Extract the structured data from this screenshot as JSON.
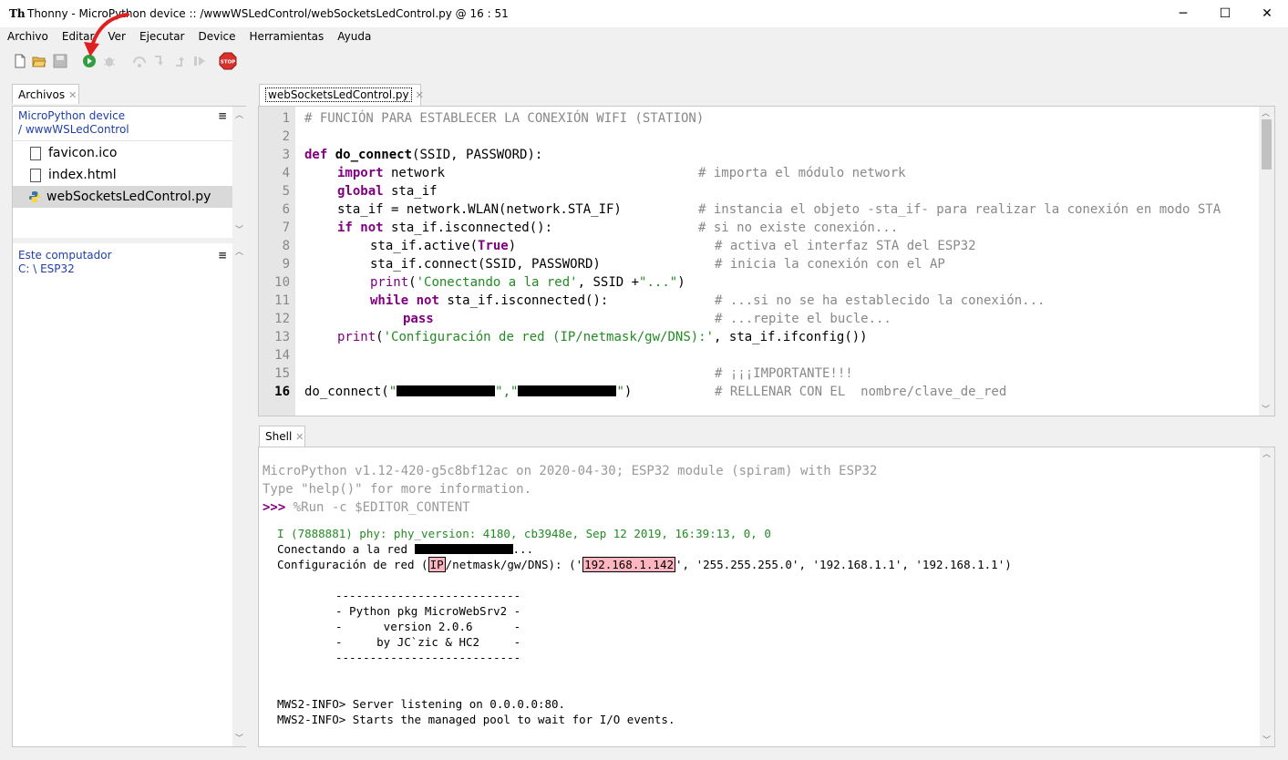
{
  "window": {
    "app_icon": "Th",
    "title": "Thonny  -  MicroPython device :: /wwwWSLedControl/webSocketsLedControl.py  @  16 : 51",
    "minimize": "─",
    "maximize": "☐",
    "close": "✕"
  },
  "menu": [
    "Archivo",
    "Editar",
    "Ver",
    "Ejecutar",
    "Device",
    "Herramientas",
    "Ayuda"
  ],
  "toolbar": {
    "icons": [
      "new-file-icon",
      "open-folder-icon",
      "save-icon",
      "run-icon",
      "debug-icon",
      "step-over-icon",
      "step-into-icon",
      "step-out-icon",
      "resume-icon",
      "stop-icon"
    ],
    "stop_label": "STOP",
    "accent_run": "#2e9e3e",
    "accent_stop": "#d9302c",
    "annotation_arrow_color": "#e02020"
  },
  "files": {
    "tab_label": "Archivos",
    "device_section": {
      "title_line1": "MicroPython device",
      "title_line2": "/ wwwWSLedControl",
      "menu": "≡",
      "items": [
        "favicon.ico",
        "index.html",
        "webSocketsLedControl.py"
      ],
      "selected": "webSocketsLedControl.py"
    },
    "local_section": {
      "title_line1": "Este computador",
      "title_line2": "C: \\ ESP32",
      "menu": "≡"
    }
  },
  "editor": {
    "tab_label": "webSocketsLedControl.py",
    "current_line": 16,
    "line_numbers": [
      "1",
      "2",
      "3",
      "4",
      "5",
      "6",
      "7",
      "8",
      "9",
      "10",
      "11",
      "12",
      "13",
      "14",
      "15",
      "16"
    ],
    "lines": {
      "l1": "# FUNCIÓN PARA ESTABLECER LA CONEXIÓN WIFI (STATION)",
      "l3_kw": "def",
      "l3_fn": "do_connect",
      "l3_rest": "(SSID, PASSWORD):",
      "l4_kw": "import",
      "l4_rest": " network",
      "l4_cm": "# importa el módulo network",
      "l5_kw": "global",
      "l5_rest": " sta_if",
      "l6_code": "sta_if = network.WLAN(network.STA_IF)",
      "l6_cm": "# instancia el objeto -sta_if- para realizar la conexión en modo STA",
      "l7_kw1": "if",
      "l7_kw2": "not",
      "l7_rest": " sta_if.isconnected():",
      "l7_cm": "# si no existe conexión...",
      "l8_code_a": "sta_if.active(",
      "l8_kw": "True",
      "l8_code_b": ")",
      "l8_cm": "# activa el interfaz STA del ESP32",
      "l9_code": "sta_if.connect(SSID, PASSWORD)",
      "l9_cm": "# inicia la conexión con el AP",
      "l10_bi": "print",
      "l10_a": "(",
      "l10_st": "'Conectando a la red'",
      "l10_b": ", SSID +",
      "l10_st2": "\"...\"",
      "l10_c": ")",
      "l11_kw1": "while",
      "l11_kw2": "not",
      "l11_rest": " sta_if.isconnected():",
      "l11_cm": "# ...si no se ha establecido la conexión...",
      "l12_kw": "pass",
      "l12_cm": "# ...repite el bucle...",
      "l13_bi": "print",
      "l13_a": "(",
      "l13_st": "'Configuración de red (IP/netmask/gw/DNS):'",
      "l13_b": ", sta_if.ifconfig())",
      "l15_cm": "# ¡¡¡IMPORTANTE!!!",
      "l16_a": "do_connect(",
      "l16_q1": "\"",
      "l16_q2": "\",\"",
      "l16_q3": "\"",
      "l16_b": ")",
      "l16_cm": "# RELLENAR CON EL  nombre/clave_de_red"
    }
  },
  "shell": {
    "tab_label": "Shell",
    "banner1": "MicroPython v1.12-420-g5c8bf12ac on 2020-04-30; ESP32 module (spiram) with ESP32",
    "banner2": "Type \"help()\" for more information.",
    "prompt": ">>>",
    "command": " %Run -c $EDITOR_CONTENT",
    "out_phy": "I (7888881) phy: phy_version: 4180, cb3948e, Sep 12 2019, 16:39:13, 0, 0",
    "out_conn_a": "Conectando a la red ",
    "out_conn_b": "...",
    "out_cfg_a": "Configuración de red (",
    "out_cfg_ip": "IP",
    "out_cfg_b": "/netmask/gw/DNS): ('",
    "out_cfg_addr": "192.168.1.142",
    "out_cfg_c": "', '255.255.255.0', '192.168.1.1', '192.168.1.1')",
    "banner_box": [
      "---------------------------",
      "- Python pkg MicroWebSrv2 -",
      "-      version 2.0.6      -",
      "-     by JC`zic & HC2     -",
      "---------------------------"
    ],
    "info1": "MWS2-INFO> Server listening on 0.0.0.0:80.",
    "info2": "MWS2-INFO> Starts the managed pool to wait for I/O events."
  }
}
